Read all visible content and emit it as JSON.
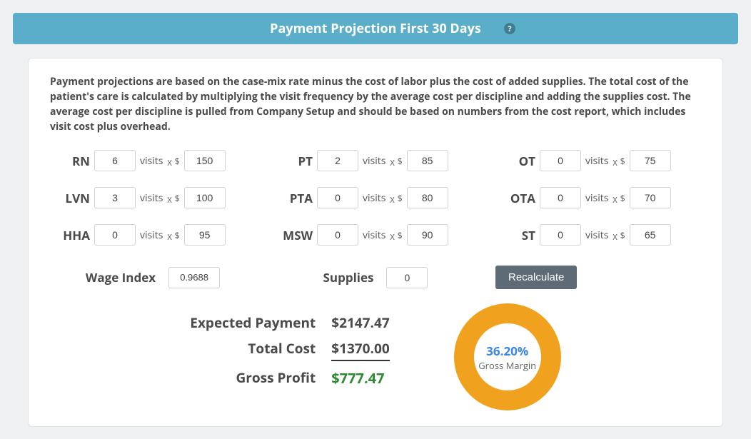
{
  "banner": {
    "title": "Payment Projection First 30 Days",
    "help_glyph": "?"
  },
  "description": "Payment projections are based on the case-mix rate minus the cost of labor plus the cost of added supplies. The total cost of the patient's care is calculated by multiplying the visit frequency by the average cost per discipline and adding the supplies cost. The average cost per discipline is pulled from Company Setup and should be based on numbers from the cost report, which includes visit cost plus overhead.",
  "visits_label": "visits",
  "x_glyph": "X",
  "dollar_glyph": "$",
  "disciplines": {
    "rn": {
      "label": "RN",
      "visits": "6",
      "rate": "150"
    },
    "pt": {
      "label": "PT",
      "visits": "2",
      "rate": "85"
    },
    "ot": {
      "label": "OT",
      "visits": "0",
      "rate": "75"
    },
    "lvn": {
      "label": "LVN",
      "visits": "3",
      "rate": "100"
    },
    "pta": {
      "label": "PTA",
      "visits": "0",
      "rate": "80"
    },
    "ota": {
      "label": "OTA",
      "visits": "0",
      "rate": "70"
    },
    "hha": {
      "label": "HHA",
      "visits": "0",
      "rate": "95"
    },
    "msw": {
      "label": "MSW",
      "visits": "0",
      "rate": "90"
    },
    "st": {
      "label": "ST",
      "visits": "0",
      "rate": "65"
    }
  },
  "wage_index": {
    "label": "Wage Index",
    "value": "0.9688"
  },
  "supplies": {
    "label": "Supplies",
    "value": "0"
  },
  "recalculate_label": "Recalculate",
  "summary": {
    "expected_label": "Expected Payment",
    "expected_value": "$2147.47",
    "total_label": "Total Cost",
    "total_value": "$1370.00",
    "profit_label": "Gross Profit",
    "profit_value": "$777.47"
  },
  "margin": {
    "percent": "36.20%",
    "label": "Gross Margin"
  }
}
